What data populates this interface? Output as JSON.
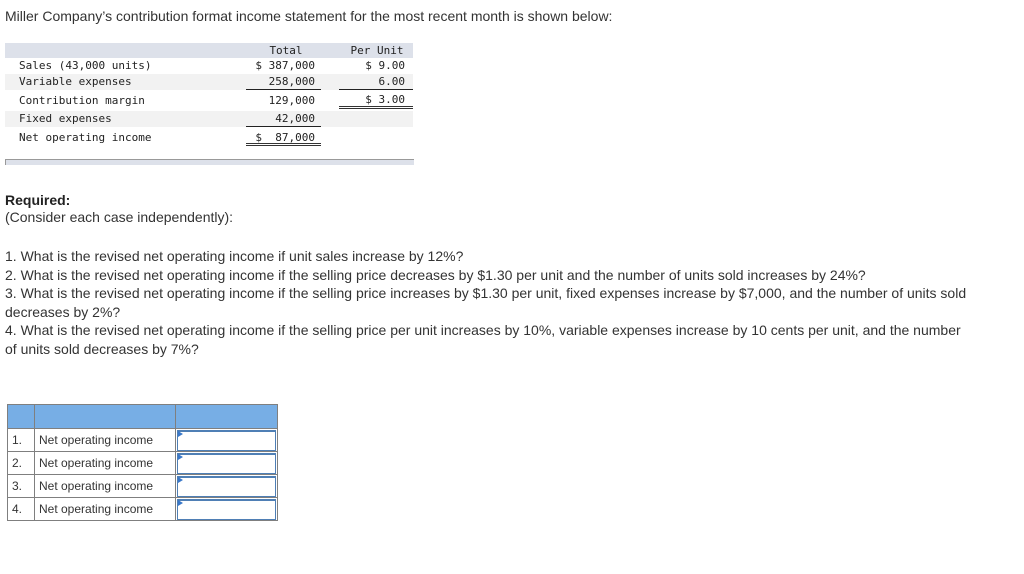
{
  "intro": "Miller Company’s contribution format income statement for the most recent month is shown below:",
  "statement": {
    "headers": {
      "total": "Total",
      "per_unit": "Per Unit"
    },
    "rows": [
      {
        "label": "Sales (43,000 units)",
        "total": "$ 387,000",
        "per_unit": "$ 9.00"
      },
      {
        "label": "Variable expenses",
        "total": "258,000",
        "per_unit": "6.00"
      },
      {
        "label": "Contribution margin",
        "total": "129,000",
        "per_unit": "$ 3.00"
      },
      {
        "label": "Fixed expenses",
        "total": "42,000",
        "per_unit": ""
      },
      {
        "label": "Net operating income",
        "total": "$  87,000",
        "per_unit": ""
      }
    ]
  },
  "required": {
    "title": "Required:",
    "subtitle": "(Consider each case independently):"
  },
  "questions": [
    "1. What is the revised net operating income if unit sales increase by 12%?",
    "2. What is the revised net operating income if the selling price decreases by $1.30 per unit and the number of units sold increases by 24%?",
    "3. What is the revised net operating income if the selling price increases by $1.30 per unit, fixed expenses increase by $7,000, and the number of units sold decreases by 2%?",
    "4. What is the revised net operating income if the selling price per unit increases by 10%, variable expenses increase by 10 cents per unit, and the number of units sold decreases by 7%?"
  ],
  "answer_table": {
    "rows": [
      {
        "num": "1.",
        "label": "Net operating income",
        "value": ""
      },
      {
        "num": "2.",
        "label": "Net operating income",
        "value": ""
      },
      {
        "num": "3.",
        "label": "Net operating income",
        "value": ""
      },
      {
        "num": "4.",
        "label": "Net operating income",
        "value": ""
      }
    ]
  }
}
